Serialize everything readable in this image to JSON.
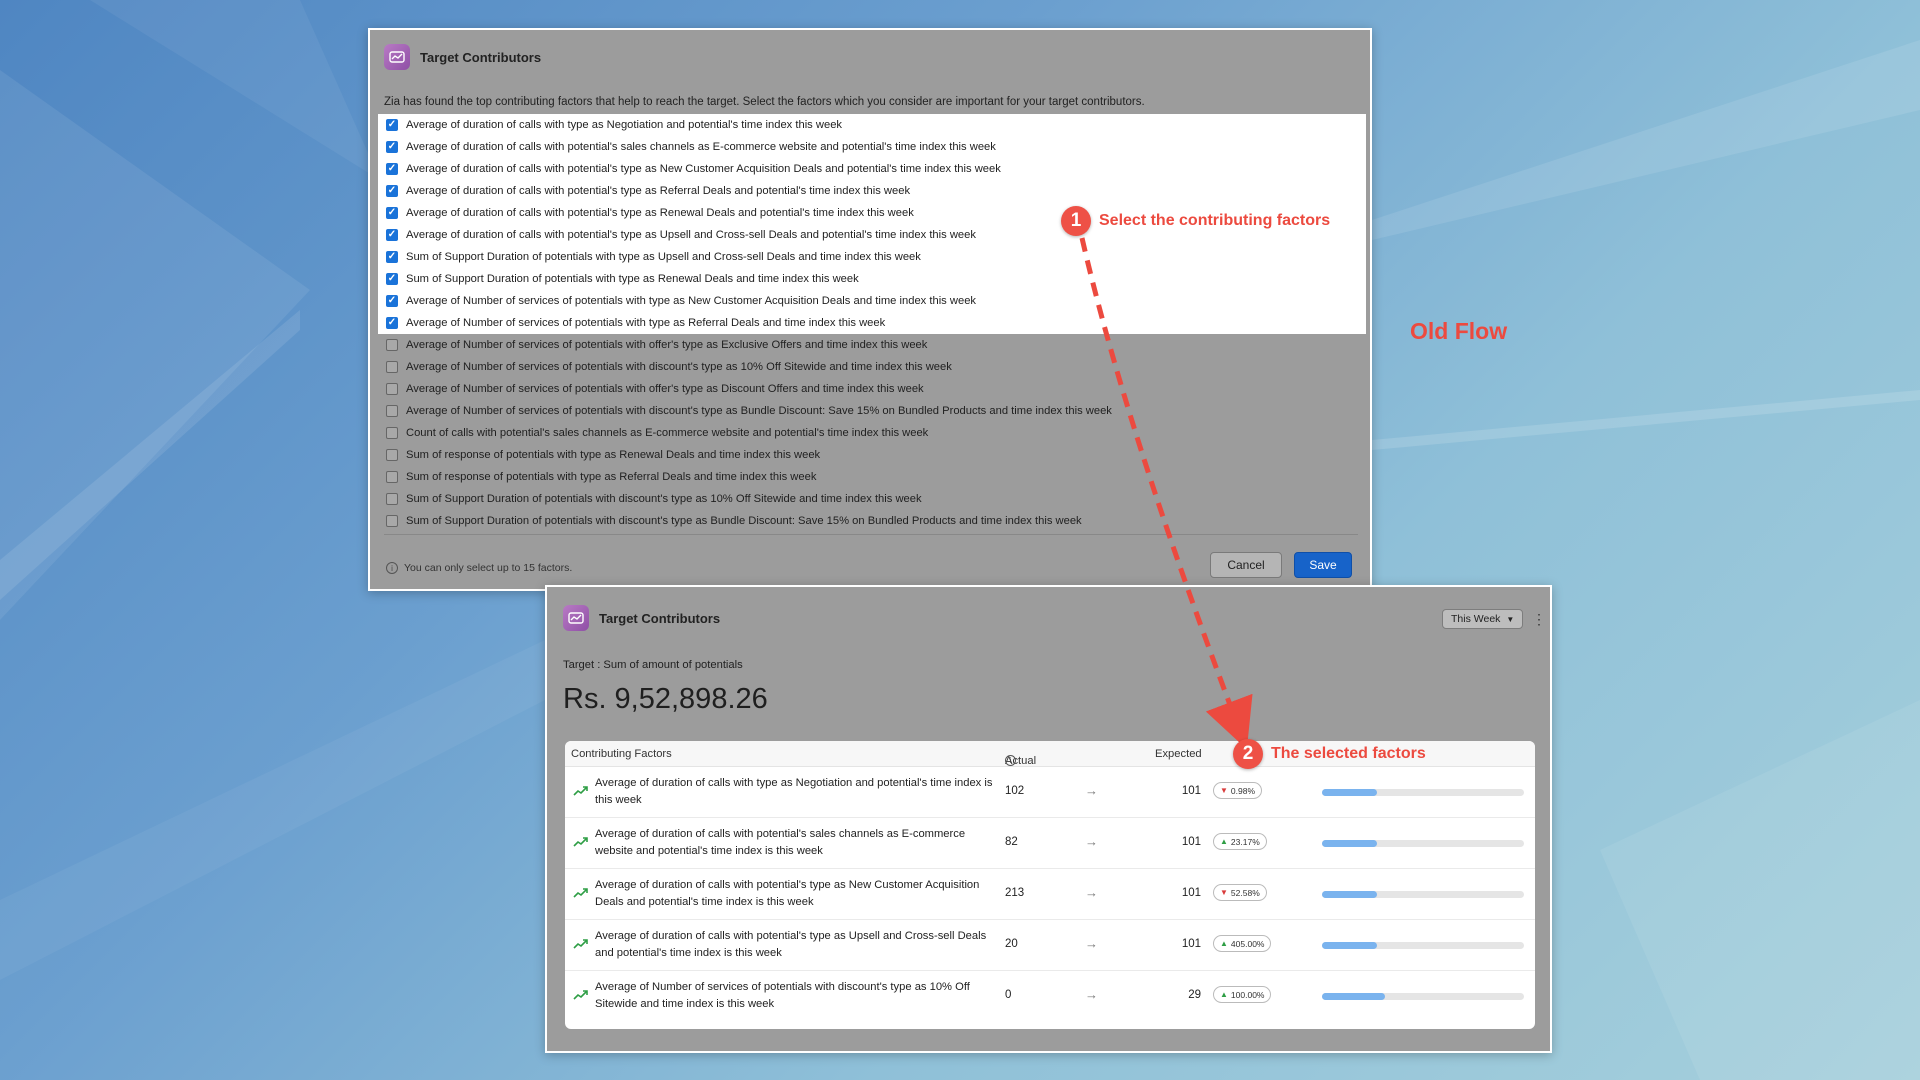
{
  "colors": {
    "accent": "#ec4a3f",
    "primary_button": "#1763c9",
    "checkbox_on": "#1a73d9",
    "trend_up": "#2e9e45",
    "trend_down": "#d93b3b",
    "progress": "#7ab3ee"
  },
  "dialog1": {
    "title": "Target Contributors",
    "icon": "target-contributors-icon",
    "description": "Zia has found the top contributing factors that help to reach the target. Select the factors which you consider are important for your target contributors.",
    "factors": [
      {
        "label": "Average of duration of calls with type as Negotiation and potential's time index this week",
        "checked": true
      },
      {
        "label": "Average of duration of calls with potential's sales channels as E-commerce website and potential's time index this week",
        "checked": true
      },
      {
        "label": "Average of duration of calls with potential's type as New Customer Acquisition Deals and potential's time index this week",
        "checked": true
      },
      {
        "label": "Average of duration of calls with potential's type as Referral Deals and potential's time index this week",
        "checked": true
      },
      {
        "label": "Average of duration of calls with potential's type as Renewal Deals and potential's time index this week",
        "checked": true
      },
      {
        "label": "Average of duration of calls with potential's type as Upsell and Cross-sell Deals and potential's time index this week",
        "checked": true
      },
      {
        "label": "Sum of Support Duration of potentials with type as Upsell and Cross-sell Deals and time index this week",
        "checked": true
      },
      {
        "label": "Sum of Support Duration of potentials with type as Renewal Deals and time index this week",
        "checked": true
      },
      {
        "label": "Average of Number of services of potentials with type as New Customer Acquisition Deals and time index this week",
        "checked": true
      },
      {
        "label": "Average of Number of services of potentials with type as Referral Deals and time index this week",
        "checked": true
      },
      {
        "label": "Average of Number of services of potentials with offer's type as Exclusive Offers and time index this week",
        "checked": false
      },
      {
        "label": "Average of Number of services of potentials with discount's type as 10% Off Sitewide and time index this week",
        "checked": false
      },
      {
        "label": "Average of Number of services of potentials with offer's type as Discount Offers and time index this week",
        "checked": false
      },
      {
        "label": "Average of Number of services of potentials with discount's type as Bundle Discount: Save 15% on Bundled Products and time index this week",
        "checked": false
      },
      {
        "label": "Count of calls with potential's sales channels as E-commerce website and potential's time index this week",
        "checked": false
      },
      {
        "label": "Sum of response of potentials with type as Renewal Deals and time index this week",
        "checked": false
      },
      {
        "label": "Sum of response of potentials with type as Referral Deals and time index this week",
        "checked": false
      },
      {
        "label": "Sum of Support Duration of potentials with discount's type as 10% Off Sitewide and time index this week",
        "checked": false
      },
      {
        "label": "Sum of Support Duration of potentials with discount's type as Bundle Discount: Save 15% on Bundled Products and time index this week",
        "checked": false
      }
    ],
    "footer_note": "You can only select up to 15 factors.",
    "cancel_label": "Cancel",
    "save_label": "Save"
  },
  "dialog2": {
    "title": "Target Contributors",
    "period": "This Week",
    "target_label": "Target : Sum of amount of potentials",
    "target_value": "Rs. 9,52,898.26",
    "columns": {
      "factors": "Contributing Factors",
      "actual": "Actual",
      "expected": "Expected"
    },
    "rows": [
      {
        "factor": "Average of duration of calls with type as Negotiation and potential's time index is this week",
        "actual": "102",
        "expected": "101",
        "change": "0.98%",
        "direction": "down",
        "progress": 0.27
      },
      {
        "factor": "Average of duration of calls with potential's sales channels as E-commerce website and potential's time index is this week",
        "actual": "82",
        "expected": "101",
        "change": "23.17%",
        "direction": "up",
        "progress": 0.27
      },
      {
        "factor": "Average of duration of calls with potential's type as New Customer Acquisition Deals and potential's time index is this week",
        "actual": "213",
        "expected": "101",
        "change": "52.58%",
        "direction": "down",
        "progress": 0.27
      },
      {
        "factor": "Average of duration of calls with potential's type as Upsell and Cross-sell Deals and potential's time index is this week",
        "actual": "20",
        "expected": "101",
        "change": "405.00%",
        "direction": "up",
        "progress": 0.27
      },
      {
        "factor": "Average of Number of services of potentials with discount's type as 10% Off Sitewide and time index is this week",
        "actual": "0",
        "expected": "29",
        "change": "100.00%",
        "direction": "up",
        "progress": 0.31
      }
    ]
  },
  "annotations": {
    "step1_number": "1",
    "step1_text": "Select the contributing factors",
    "step2_number": "2",
    "step2_text": "The selected factors",
    "flow_label": "Old Flow"
  }
}
